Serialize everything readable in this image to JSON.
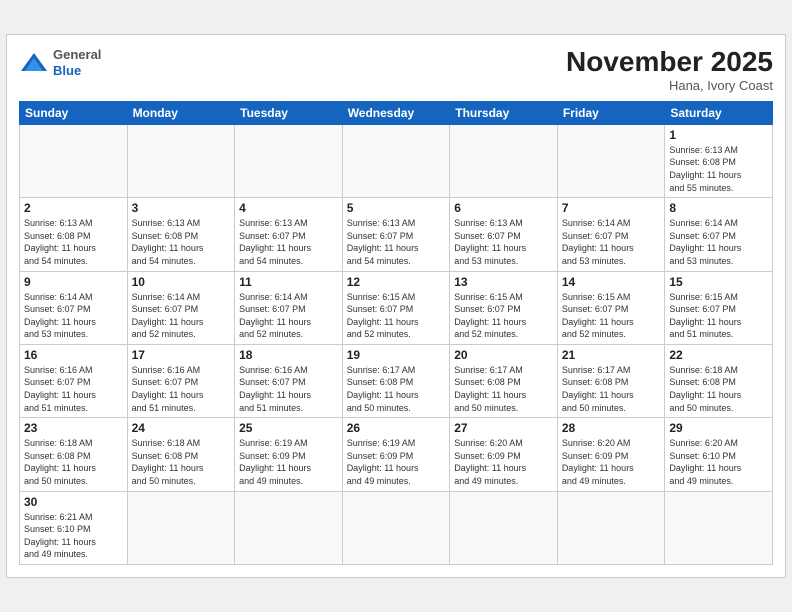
{
  "header": {
    "logo_general": "General",
    "logo_blue": "Blue",
    "month_title": "November 2025",
    "subtitle": "Hana, Ivory Coast"
  },
  "weekdays": [
    "Sunday",
    "Monday",
    "Tuesday",
    "Wednesday",
    "Thursday",
    "Friday",
    "Saturday"
  ],
  "weeks": [
    [
      {
        "day": "",
        "info": ""
      },
      {
        "day": "",
        "info": ""
      },
      {
        "day": "",
        "info": ""
      },
      {
        "day": "",
        "info": ""
      },
      {
        "day": "",
        "info": ""
      },
      {
        "day": "",
        "info": ""
      },
      {
        "day": "1",
        "info": "Sunrise: 6:13 AM\nSunset: 6:08 PM\nDaylight: 11 hours\nand 55 minutes."
      }
    ],
    [
      {
        "day": "2",
        "info": "Sunrise: 6:13 AM\nSunset: 6:08 PM\nDaylight: 11 hours\nand 54 minutes."
      },
      {
        "day": "3",
        "info": "Sunrise: 6:13 AM\nSunset: 6:08 PM\nDaylight: 11 hours\nand 54 minutes."
      },
      {
        "day": "4",
        "info": "Sunrise: 6:13 AM\nSunset: 6:07 PM\nDaylight: 11 hours\nand 54 minutes."
      },
      {
        "day": "5",
        "info": "Sunrise: 6:13 AM\nSunset: 6:07 PM\nDaylight: 11 hours\nand 54 minutes."
      },
      {
        "day": "6",
        "info": "Sunrise: 6:13 AM\nSunset: 6:07 PM\nDaylight: 11 hours\nand 53 minutes."
      },
      {
        "day": "7",
        "info": "Sunrise: 6:14 AM\nSunset: 6:07 PM\nDaylight: 11 hours\nand 53 minutes."
      },
      {
        "day": "8",
        "info": "Sunrise: 6:14 AM\nSunset: 6:07 PM\nDaylight: 11 hours\nand 53 minutes."
      }
    ],
    [
      {
        "day": "9",
        "info": "Sunrise: 6:14 AM\nSunset: 6:07 PM\nDaylight: 11 hours\nand 53 minutes."
      },
      {
        "day": "10",
        "info": "Sunrise: 6:14 AM\nSunset: 6:07 PM\nDaylight: 11 hours\nand 52 minutes."
      },
      {
        "day": "11",
        "info": "Sunrise: 6:14 AM\nSunset: 6:07 PM\nDaylight: 11 hours\nand 52 minutes."
      },
      {
        "day": "12",
        "info": "Sunrise: 6:15 AM\nSunset: 6:07 PM\nDaylight: 11 hours\nand 52 minutes."
      },
      {
        "day": "13",
        "info": "Sunrise: 6:15 AM\nSunset: 6:07 PM\nDaylight: 11 hours\nand 52 minutes."
      },
      {
        "day": "14",
        "info": "Sunrise: 6:15 AM\nSunset: 6:07 PM\nDaylight: 11 hours\nand 52 minutes."
      },
      {
        "day": "15",
        "info": "Sunrise: 6:15 AM\nSunset: 6:07 PM\nDaylight: 11 hours\nand 51 minutes."
      }
    ],
    [
      {
        "day": "16",
        "info": "Sunrise: 6:16 AM\nSunset: 6:07 PM\nDaylight: 11 hours\nand 51 minutes."
      },
      {
        "day": "17",
        "info": "Sunrise: 6:16 AM\nSunset: 6:07 PM\nDaylight: 11 hours\nand 51 minutes."
      },
      {
        "day": "18",
        "info": "Sunrise: 6:16 AM\nSunset: 6:07 PM\nDaylight: 11 hours\nand 51 minutes."
      },
      {
        "day": "19",
        "info": "Sunrise: 6:17 AM\nSunset: 6:08 PM\nDaylight: 11 hours\nand 50 minutes."
      },
      {
        "day": "20",
        "info": "Sunrise: 6:17 AM\nSunset: 6:08 PM\nDaylight: 11 hours\nand 50 minutes."
      },
      {
        "day": "21",
        "info": "Sunrise: 6:17 AM\nSunset: 6:08 PM\nDaylight: 11 hours\nand 50 minutes."
      },
      {
        "day": "22",
        "info": "Sunrise: 6:18 AM\nSunset: 6:08 PM\nDaylight: 11 hours\nand 50 minutes."
      }
    ],
    [
      {
        "day": "23",
        "info": "Sunrise: 6:18 AM\nSunset: 6:08 PM\nDaylight: 11 hours\nand 50 minutes."
      },
      {
        "day": "24",
        "info": "Sunrise: 6:18 AM\nSunset: 6:08 PM\nDaylight: 11 hours\nand 50 minutes."
      },
      {
        "day": "25",
        "info": "Sunrise: 6:19 AM\nSunset: 6:09 PM\nDaylight: 11 hours\nand 49 minutes."
      },
      {
        "day": "26",
        "info": "Sunrise: 6:19 AM\nSunset: 6:09 PM\nDaylight: 11 hours\nand 49 minutes."
      },
      {
        "day": "27",
        "info": "Sunrise: 6:20 AM\nSunset: 6:09 PM\nDaylight: 11 hours\nand 49 minutes."
      },
      {
        "day": "28",
        "info": "Sunrise: 6:20 AM\nSunset: 6:09 PM\nDaylight: 11 hours\nand 49 minutes."
      },
      {
        "day": "29",
        "info": "Sunrise: 6:20 AM\nSunset: 6:10 PM\nDaylight: 11 hours\nand 49 minutes."
      }
    ],
    [
      {
        "day": "30",
        "info": "Sunrise: 6:21 AM\nSunset: 6:10 PM\nDaylight: 11 hours\nand 49 minutes."
      },
      {
        "day": "",
        "info": ""
      },
      {
        "day": "",
        "info": ""
      },
      {
        "day": "",
        "info": ""
      },
      {
        "day": "",
        "info": ""
      },
      {
        "day": "",
        "info": ""
      },
      {
        "day": "",
        "info": ""
      }
    ]
  ]
}
